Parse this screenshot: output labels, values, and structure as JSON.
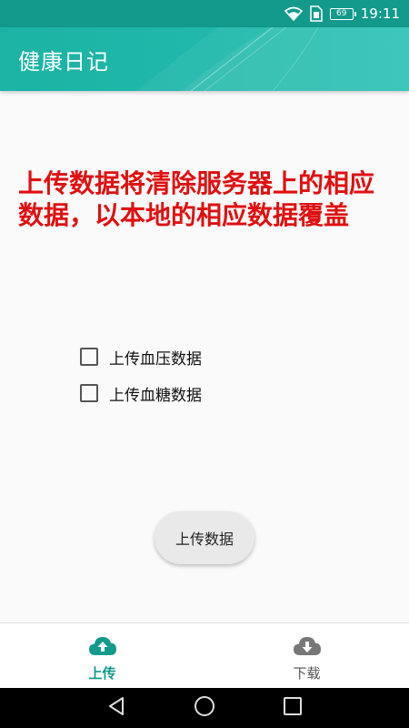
{
  "status_bar": {
    "battery_level": "69",
    "time": "19:11",
    "icons": [
      "wifi-icon",
      "sim-icon",
      "battery-icon"
    ]
  },
  "app_bar": {
    "title": "健康日记"
  },
  "content": {
    "warning_text": "上传数据将清除服务器上的相应数据，以本地的相应数据覆盖",
    "options": [
      {
        "label": "上传血压数据",
        "checked": false
      },
      {
        "label": "上传血糖数据",
        "checked": false
      }
    ],
    "upload_button_label": "上传数据"
  },
  "bottom_nav": {
    "items": [
      {
        "label": "上传",
        "icon": "cloud-upload-icon",
        "active": true
      },
      {
        "label": "下载",
        "icon": "cloud-download-icon",
        "active": false
      }
    ]
  },
  "system_nav": {
    "icons": [
      "back-icon",
      "home-icon",
      "recents-icon"
    ]
  },
  "colors": {
    "accent": "#139a8c",
    "warning": "#e01010"
  }
}
